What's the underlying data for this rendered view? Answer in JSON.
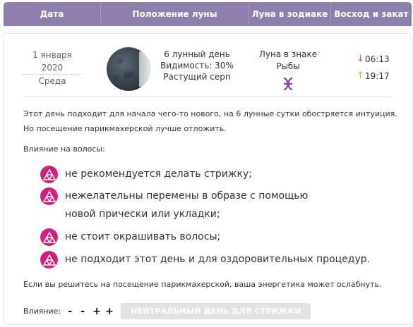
{
  "header": {
    "col1": "Дата",
    "col2": "Положение луны",
    "col3": "Луна в зодиаке",
    "col4": "Восход и закат"
  },
  "day": {
    "date": "1 января 2020",
    "weekday": "Среда"
  },
  "phase": {
    "day_label": "6 лунный день",
    "visibility": "Видимость: 30%",
    "phase_name": "Растущий серп"
  },
  "zodiac": {
    "line1": "Луна в знаке",
    "line2": "Рыбы",
    "icon": "pisces-icon",
    "icon_color": "#8a3ab8"
  },
  "times": {
    "set": "06:13",
    "rise": "19:17",
    "down_arrow": "↓",
    "up_arrow": "↑"
  },
  "body": {
    "intro": "Этот день подходит для начала чего-то нового, на 6 лунные сутки обостряется интуиция. Но посещение парикмахерской лучше отложить.",
    "influence_label": "Влияние на волосы:",
    "items": [
      "не рекомендуется делать стрижку;",
      "нежелательны перемены в образе с помощью новой прически или укладки;",
      "не стоит окрашивать волосы;",
      "не подходит этот день и для оздоровительных процедур."
    ],
    "outro": "Если вы решитесь на посещение парикмахерской, ваша энергетика может ослабнуть."
  },
  "footer": {
    "label": "Влияние:",
    "signs": [
      "-",
      "-",
      "+",
      "+"
    ],
    "badge": "НЕЙТРАЛЬНЫЙ ДЕНЬ ДЛЯ СТРИЖКИ"
  },
  "colors": {
    "header_bg": "#8e7eab",
    "icon_bg": "#d2217c",
    "badge_bg": "#e2e2e2"
  }
}
